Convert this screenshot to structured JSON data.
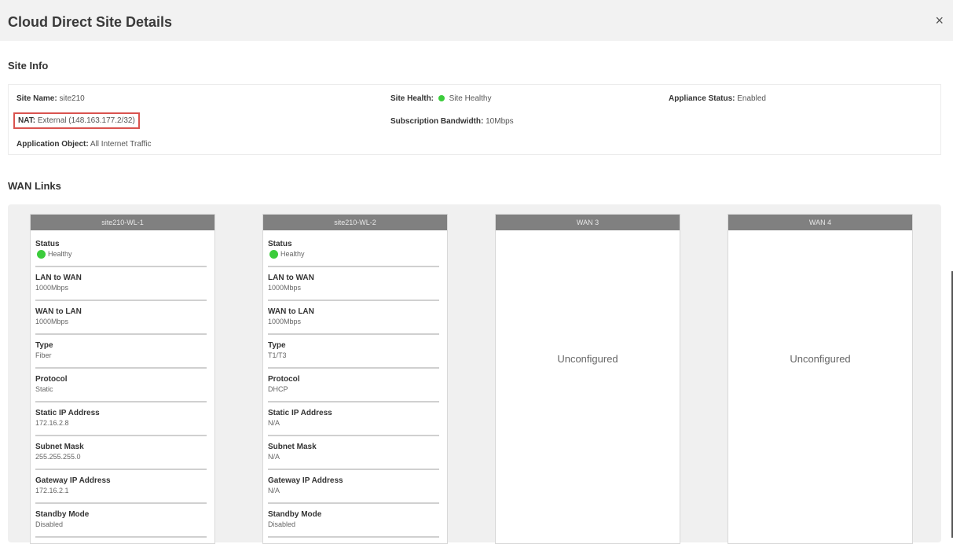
{
  "modal": {
    "title": "Cloud Direct Site Details",
    "close_glyph": "×"
  },
  "site_info": {
    "section_title": "Site Info",
    "site_name_label": "Site Name:",
    "site_name_value": "site210",
    "site_health_label": "Site Health:",
    "site_health_value": "Site Healthy",
    "appliance_status_label": "Appliance Status:",
    "appliance_status_value": "Enabled",
    "nat_label": "NAT:",
    "nat_value": "External (148.163.177.2/32)",
    "subscription_bandwidth_label": "Subscription Bandwidth:",
    "subscription_bandwidth_value": "10Mbps",
    "application_object_label": "Application Object:",
    "application_object_value": "All Internet Traffic"
  },
  "wan_links": {
    "section_title": "WAN Links",
    "labels": {
      "status": "Status",
      "lan_to_wan": "LAN to WAN",
      "wan_to_lan": "WAN to LAN",
      "type": "Type",
      "protocol": "Protocol",
      "static_ip": "Static IP Address",
      "subnet_mask": "Subnet Mask",
      "gateway_ip": "Gateway IP Address",
      "standby_mode": "Standby Mode"
    },
    "links": [
      {
        "name": "site210-WL-1",
        "status": "Healthy",
        "lan_to_wan": "1000Mbps",
        "wan_to_lan": "1000Mbps",
        "type": "Fiber",
        "protocol": "Static",
        "static_ip": "172.16.2.8",
        "subnet_mask": "255.255.255.0",
        "gateway_ip": "172.16.2.1",
        "standby_mode": "Disabled"
      },
      {
        "name": "site210-WL-2",
        "status": "Healthy",
        "lan_to_wan": "1000Mbps",
        "wan_to_lan": "1000Mbps",
        "type": "T1/T3",
        "protocol": "DHCP",
        "static_ip": "N/A",
        "subnet_mask": "N/A",
        "gateway_ip": "N/A",
        "standby_mode": "Disabled"
      },
      {
        "name": "WAN 3",
        "state": "Unconfigured"
      },
      {
        "name": "WAN 4",
        "state": "Unconfigured"
      }
    ]
  },
  "colors": {
    "healthy": "#3ccc3c",
    "nat_highlight": "#d9534f",
    "card_header": "#808080"
  }
}
